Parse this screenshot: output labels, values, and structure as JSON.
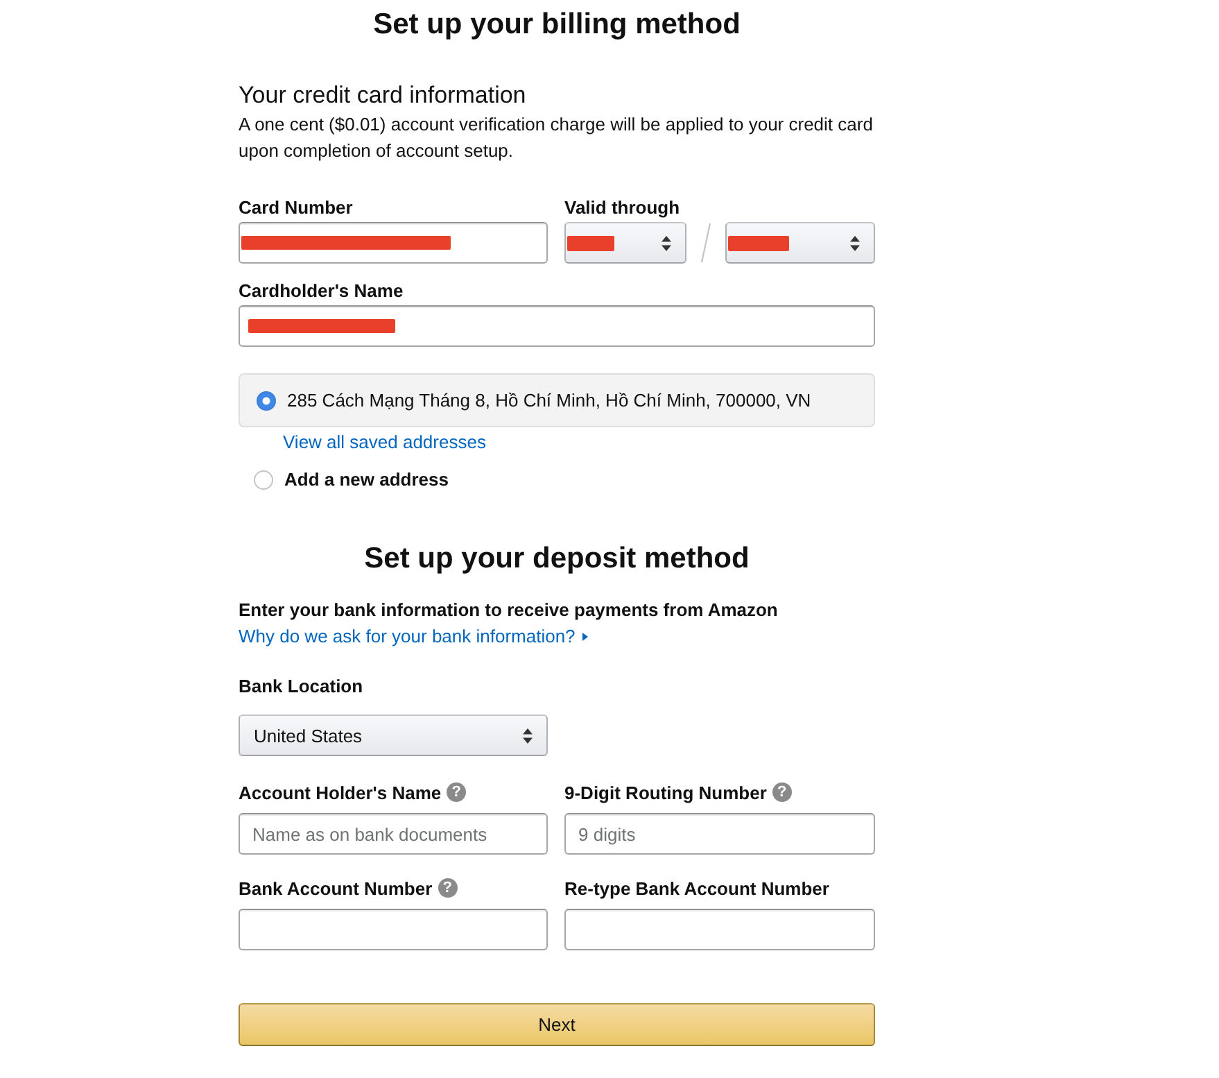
{
  "billing": {
    "title": "Set up your billing method",
    "subtitle": "Your credit card information",
    "note": "A one cent ($0.01) account verification charge will be applied to your credit card upon completion of account setup.",
    "card_number": {
      "label": "Card Number",
      "redacted": true
    },
    "valid_through": {
      "label": "Valid through",
      "month": {
        "redacted": true
      },
      "year": {
        "redacted": true
      }
    },
    "cardholder_name": {
      "label": "Cardholder's Name",
      "redacted": true
    },
    "address_options": [
      {
        "kind": "saved",
        "label": "285 Cách Mạng Tháng 8, Hồ Chí Minh, Hồ Chí Minh, 700000, VN",
        "selected": true
      },
      {
        "kind": "new",
        "label": "Add a new address",
        "selected": false
      }
    ],
    "saved_addresses_link": "View all saved addresses"
  },
  "deposit": {
    "title": "Set up your deposit method",
    "intro": "Enter your bank information to receive payments from Amazon",
    "help_link": "Why do we ask for your bank information?",
    "bank_location": {
      "label": "Bank Location",
      "value": "United States"
    },
    "fields": [
      {
        "label": "Account Holder's Name",
        "help": "?",
        "placeholder": "Name as on bank documents"
      },
      {
        "label": "9-Digit Routing Number",
        "help": "?",
        "placeholder": "9 digits"
      },
      {
        "label": "Bank Account Number",
        "help": "?"
      },
      {
        "label": "Re-type Bank Account Number"
      }
    ]
  },
  "next_button": "Next"
}
